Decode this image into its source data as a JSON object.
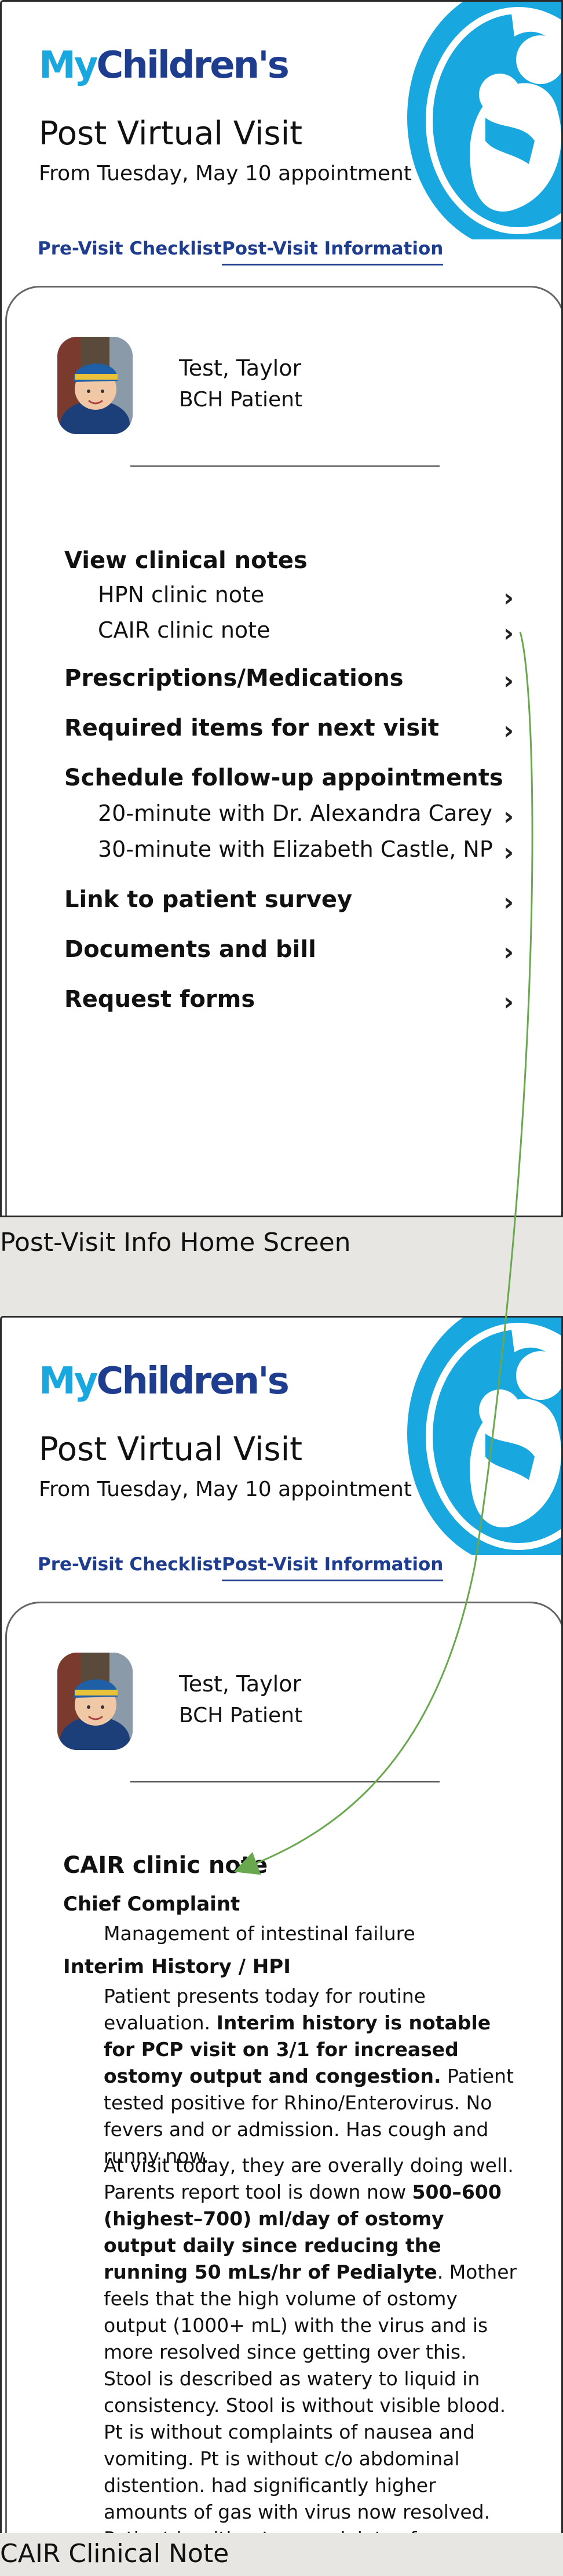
{
  "brand": {
    "my": "My",
    "children": "Children's"
  },
  "screens": [
    {
      "title": "Post Virtual Visit",
      "subtitle": "From Tuesday, May 10 appointment",
      "tabs": [
        "Pre-Visit Checklist",
        "Post-Visit Information"
      ],
      "patient": {
        "name": "Test, Taylor",
        "role": "BCH Patient"
      },
      "caption": "Post-Visit Info Home Screen",
      "menu": [
        {
          "label": "View clinical notes",
          "type": "heading"
        },
        {
          "label": "HPN clinic note",
          "type": "sub"
        },
        {
          "label": "CAIR clinic note",
          "type": "sub"
        },
        {
          "label": "Prescriptions/Medications",
          "type": "item"
        },
        {
          "label": "Required  items for next visit",
          "type": "item"
        },
        {
          "label": "Schedule follow-up appointments",
          "type": "heading"
        },
        {
          "label": "20-minute with Dr. Alexandra Carey",
          "type": "sub"
        },
        {
          "label": "30-minute with Elizabeth Castle, NP",
          "type": "sub"
        },
        {
          "label": "Link to patient survey",
          "type": "item"
        },
        {
          "label": "Documents and bill",
          "type": "item"
        },
        {
          "label": "Request forms",
          "type": "item"
        }
      ]
    },
    {
      "title": "Post Virtual Visit",
      "subtitle": "From Tuesday, May 10 appointment",
      "tabs": [
        "Pre-Visit Checklist",
        "Post-Visit Information"
      ],
      "patient": {
        "name": "Test, Taylor",
        "role": "BCH Patient"
      },
      "caption": "CAIR Clinical Note",
      "note": {
        "title": "CAIR clinic note",
        "chief_complaint_label": "Chief Complaint",
        "chief_complaint": "Management of intestinal failure",
        "hpi_label": "Interim History / HPI",
        "p1_a": "Patient presents today for routine evaluation. ",
        "p1_b": "Interim history is notable for PCP visit on 3/1 for increased ostomy output and congestion.",
        "p1_c": " Patient tested positive for Rhino/Enterovirus. No fevers and or admission. Has cough and runny now.",
        "p2_a": "At visit today, they are overally doing well. Parents report tool is down now ",
        "p2_b": "500–600 (highest–700) ml/day of ostomy output daily since reducing the running 50 mLs/hr of Pedialyte",
        "p2_c": ". Mother feels that the high volume of ostomy output (1000+ mL) with the virus and is more resolved since getting over this. Stool is described as watery to liquid in consistency. Stool is without visible blood. Pt is without complaints of nausea and vomiting. Pt is without c/o abdominal distention. had significantly higher amounts of gas with virus now resolved. Patient is without comoplaints of abdominal pain. Family reports that urine was very strong"
      }
    }
  ],
  "colors": {
    "brand_light": "#18a7df",
    "brand_dark": "#1f3d8e",
    "arrow": "#6aa84f"
  }
}
